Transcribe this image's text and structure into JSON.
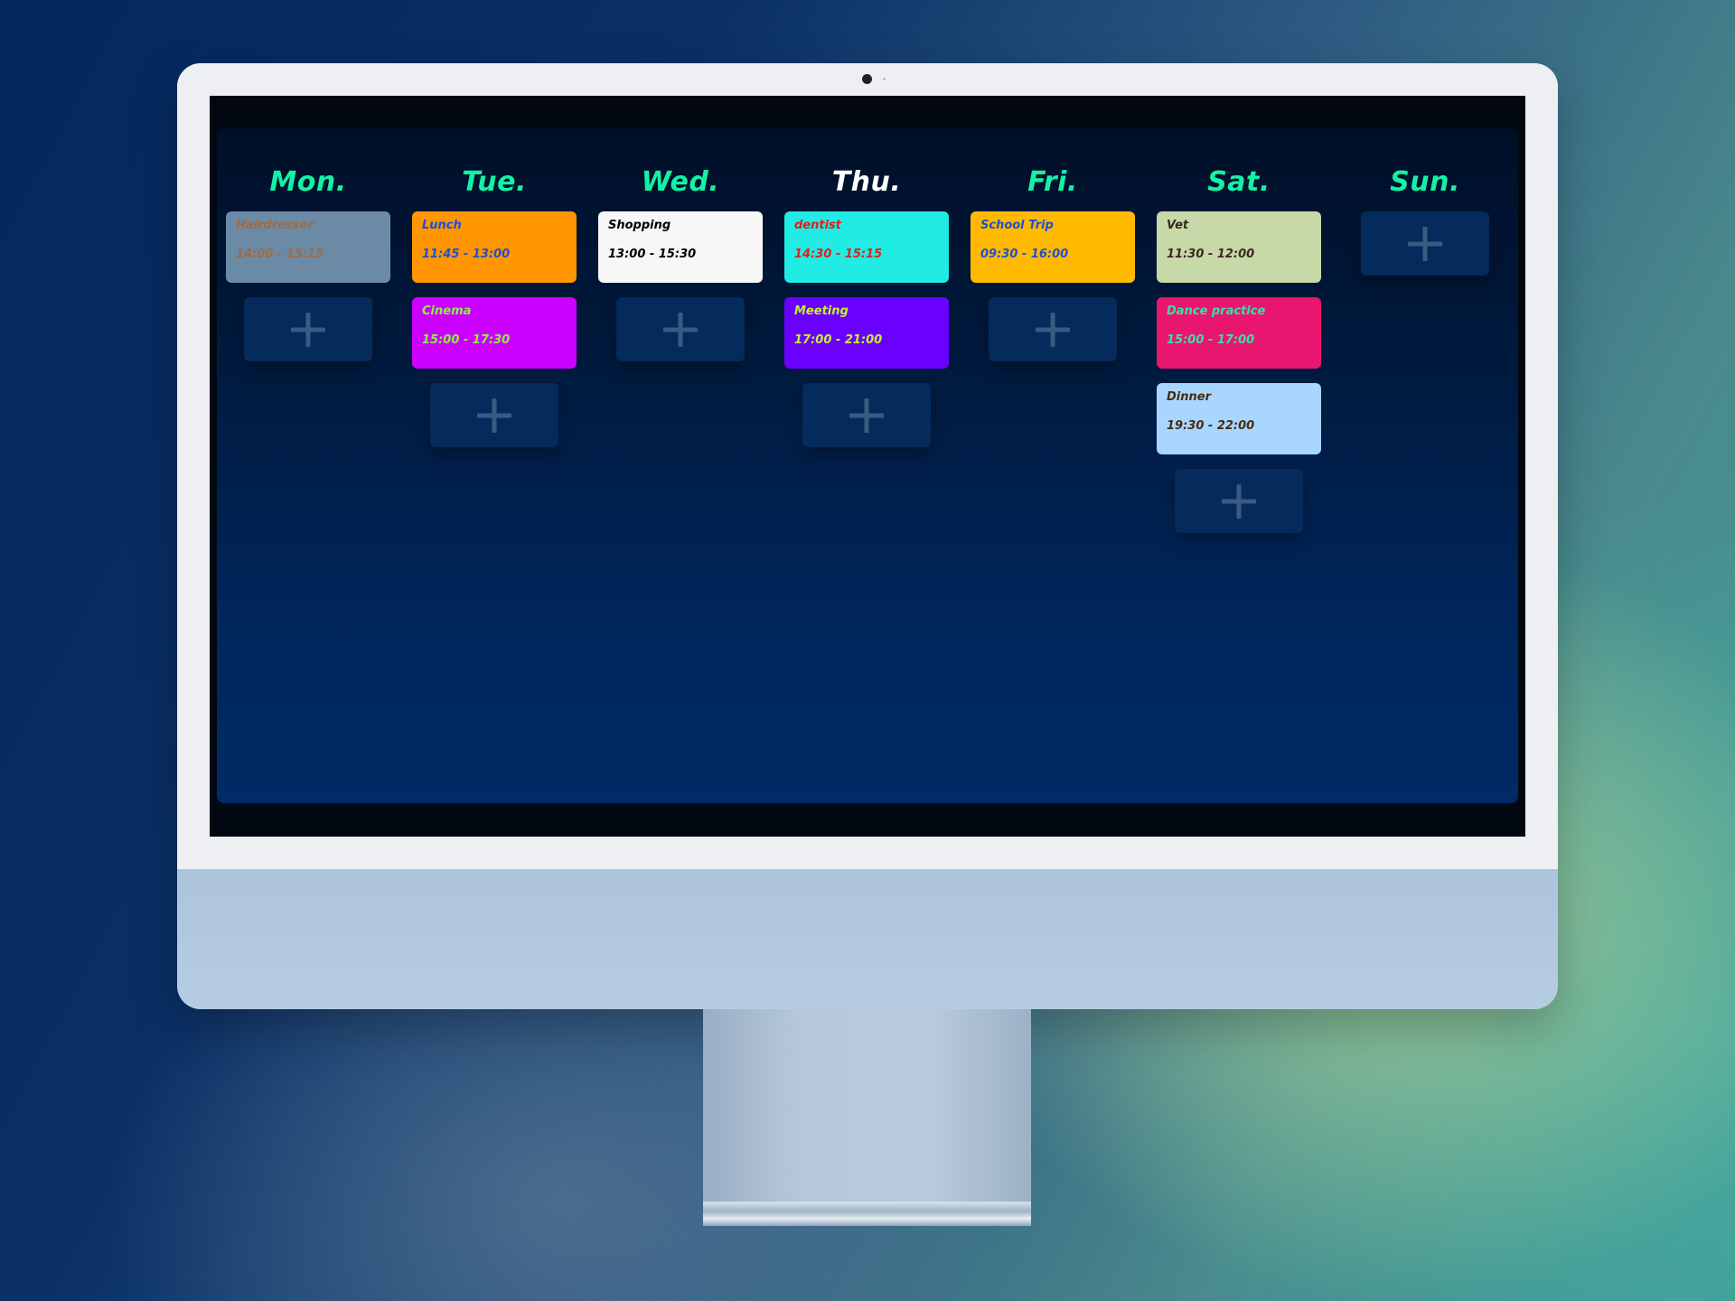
{
  "days": [
    {
      "name": "Mon.",
      "name_color": "#13f2a4",
      "events": [
        {
          "title": "Hairdresser",
          "time": "14:00 - 15:15",
          "bg": "#6b8aa6",
          "fg": "#a3693f"
        }
      ]
    },
    {
      "name": "Tue.",
      "name_color": "#13f2a4",
      "events": [
        {
          "title": "Lunch",
          "time": "11:45 - 13:00",
          "bg": "#ff9500",
          "fg": "#1d4fd8"
        },
        {
          "title": "Cinema",
          "time": "15:00 - 17:30",
          "bg": "#cc00ff",
          "fg": "#8af23c"
        }
      ]
    },
    {
      "name": "Wed.",
      "name_color": "#13f2a4",
      "events": [
        {
          "title": "Shopping",
          "time": "13:00 - 15:30",
          "bg": "#f7f7f7",
          "fg": "#000000"
        }
      ]
    },
    {
      "name": "Thu.",
      "name_color": "#ffffff",
      "events": [
        {
          "title": "dentist",
          "time": "14:30 - 15:15",
          "bg": "#20ece4",
          "fg": "#e0201a"
        },
        {
          "title": "Meeting",
          "time": "17:00 - 21:00",
          "bg": "#6a00ff",
          "fg": "#c6f22a"
        }
      ]
    },
    {
      "name": "Fri.",
      "name_color": "#13f2a4",
      "events": [
        {
          "title": "School Trip",
          "time": "09:30 - 16:00",
          "bg": "#ffba00",
          "fg": "#1d4fd8"
        }
      ]
    },
    {
      "name": "Sat.",
      "name_color": "#13f2a4",
      "events": [
        {
          "title": "Vet",
          "time": "11:30 - 12:00",
          "bg": "#c7d9a7",
          "fg": "#3b2626"
        },
        {
          "title": "Dance practice",
          "time": "15:00 - 17:00",
          "bg": "#e8166e",
          "fg": "#36e2a6"
        },
        {
          "title": "Dinner",
          "time": "19:30 - 22:00",
          "bg": "#a8d6ff",
          "fg": "#4a2a10"
        }
      ]
    },
    {
      "name": "Sun.",
      "name_color": "#13f2a4",
      "events": []
    }
  ],
  "add_button": {
    "icon": "plus-icon",
    "bg": "#052a5c",
    "icon_color": "#3a5b80"
  }
}
